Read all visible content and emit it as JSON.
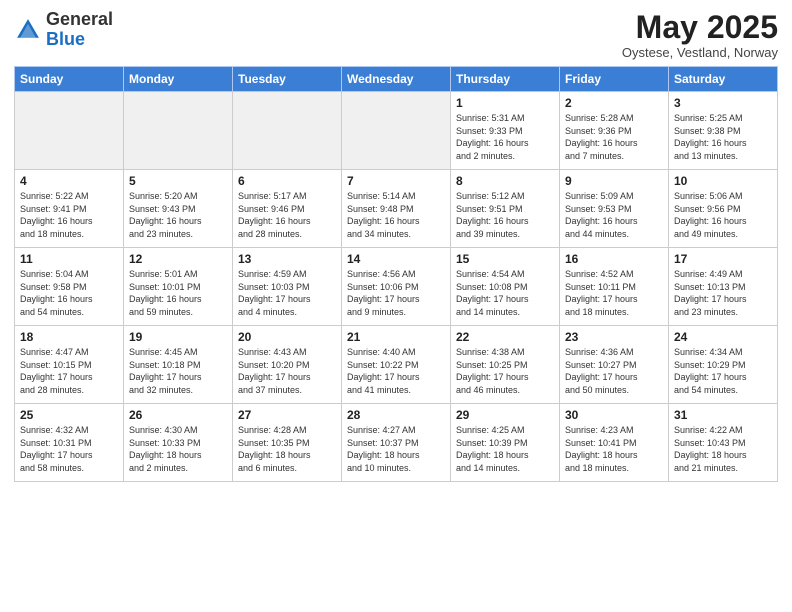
{
  "header": {
    "logo_general": "General",
    "logo_blue": "Blue",
    "main_title": "May 2025",
    "subtitle": "Oystese, Vestland, Norway"
  },
  "calendar": {
    "days_of_week": [
      "Sunday",
      "Monday",
      "Tuesday",
      "Wednesday",
      "Thursday",
      "Friday",
      "Saturday"
    ],
    "weeks": [
      [
        {
          "day": "",
          "info": ""
        },
        {
          "day": "",
          "info": ""
        },
        {
          "day": "",
          "info": ""
        },
        {
          "day": "",
          "info": ""
        },
        {
          "day": "1",
          "info": "Sunrise: 5:31 AM\nSunset: 9:33 PM\nDaylight: 16 hours\nand 2 minutes."
        },
        {
          "day": "2",
          "info": "Sunrise: 5:28 AM\nSunset: 9:36 PM\nDaylight: 16 hours\nand 7 minutes."
        },
        {
          "day": "3",
          "info": "Sunrise: 5:25 AM\nSunset: 9:38 PM\nDaylight: 16 hours\nand 13 minutes."
        }
      ],
      [
        {
          "day": "4",
          "info": "Sunrise: 5:22 AM\nSunset: 9:41 PM\nDaylight: 16 hours\nand 18 minutes."
        },
        {
          "day": "5",
          "info": "Sunrise: 5:20 AM\nSunset: 9:43 PM\nDaylight: 16 hours\nand 23 minutes."
        },
        {
          "day": "6",
          "info": "Sunrise: 5:17 AM\nSunset: 9:46 PM\nDaylight: 16 hours\nand 28 minutes."
        },
        {
          "day": "7",
          "info": "Sunrise: 5:14 AM\nSunset: 9:48 PM\nDaylight: 16 hours\nand 34 minutes."
        },
        {
          "day": "8",
          "info": "Sunrise: 5:12 AM\nSunset: 9:51 PM\nDaylight: 16 hours\nand 39 minutes."
        },
        {
          "day": "9",
          "info": "Sunrise: 5:09 AM\nSunset: 9:53 PM\nDaylight: 16 hours\nand 44 minutes."
        },
        {
          "day": "10",
          "info": "Sunrise: 5:06 AM\nSunset: 9:56 PM\nDaylight: 16 hours\nand 49 minutes."
        }
      ],
      [
        {
          "day": "11",
          "info": "Sunrise: 5:04 AM\nSunset: 9:58 PM\nDaylight: 16 hours\nand 54 minutes."
        },
        {
          "day": "12",
          "info": "Sunrise: 5:01 AM\nSunset: 10:01 PM\nDaylight: 16 hours\nand 59 minutes."
        },
        {
          "day": "13",
          "info": "Sunrise: 4:59 AM\nSunset: 10:03 PM\nDaylight: 17 hours\nand 4 minutes."
        },
        {
          "day": "14",
          "info": "Sunrise: 4:56 AM\nSunset: 10:06 PM\nDaylight: 17 hours\nand 9 minutes."
        },
        {
          "day": "15",
          "info": "Sunrise: 4:54 AM\nSunset: 10:08 PM\nDaylight: 17 hours\nand 14 minutes."
        },
        {
          "day": "16",
          "info": "Sunrise: 4:52 AM\nSunset: 10:11 PM\nDaylight: 17 hours\nand 18 minutes."
        },
        {
          "day": "17",
          "info": "Sunrise: 4:49 AM\nSunset: 10:13 PM\nDaylight: 17 hours\nand 23 minutes."
        }
      ],
      [
        {
          "day": "18",
          "info": "Sunrise: 4:47 AM\nSunset: 10:15 PM\nDaylight: 17 hours\nand 28 minutes."
        },
        {
          "day": "19",
          "info": "Sunrise: 4:45 AM\nSunset: 10:18 PM\nDaylight: 17 hours\nand 32 minutes."
        },
        {
          "day": "20",
          "info": "Sunrise: 4:43 AM\nSunset: 10:20 PM\nDaylight: 17 hours\nand 37 minutes."
        },
        {
          "day": "21",
          "info": "Sunrise: 4:40 AM\nSunset: 10:22 PM\nDaylight: 17 hours\nand 41 minutes."
        },
        {
          "day": "22",
          "info": "Sunrise: 4:38 AM\nSunset: 10:25 PM\nDaylight: 17 hours\nand 46 minutes."
        },
        {
          "day": "23",
          "info": "Sunrise: 4:36 AM\nSunset: 10:27 PM\nDaylight: 17 hours\nand 50 minutes."
        },
        {
          "day": "24",
          "info": "Sunrise: 4:34 AM\nSunset: 10:29 PM\nDaylight: 17 hours\nand 54 minutes."
        }
      ],
      [
        {
          "day": "25",
          "info": "Sunrise: 4:32 AM\nSunset: 10:31 PM\nDaylight: 17 hours\nand 58 minutes."
        },
        {
          "day": "26",
          "info": "Sunrise: 4:30 AM\nSunset: 10:33 PM\nDaylight: 18 hours\nand 2 minutes."
        },
        {
          "day": "27",
          "info": "Sunrise: 4:28 AM\nSunset: 10:35 PM\nDaylight: 18 hours\nand 6 minutes."
        },
        {
          "day": "28",
          "info": "Sunrise: 4:27 AM\nSunset: 10:37 PM\nDaylight: 18 hours\nand 10 minutes."
        },
        {
          "day": "29",
          "info": "Sunrise: 4:25 AM\nSunset: 10:39 PM\nDaylight: 18 hours\nand 14 minutes."
        },
        {
          "day": "30",
          "info": "Sunrise: 4:23 AM\nSunset: 10:41 PM\nDaylight: 18 hours\nand 18 minutes."
        },
        {
          "day": "31",
          "info": "Sunrise: 4:22 AM\nSunset: 10:43 PM\nDaylight: 18 hours\nand 21 minutes."
        }
      ]
    ]
  }
}
